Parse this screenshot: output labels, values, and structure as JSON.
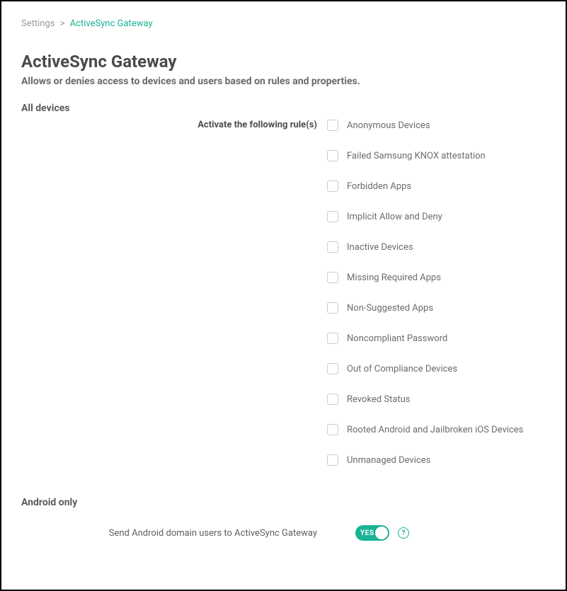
{
  "breadcrumb": {
    "parent": "Settings",
    "current": "ActiveSync Gateway"
  },
  "header": {
    "title": "ActiveSync Gateway",
    "subtitle": "Allows or denies access to devices and users based on rules and properties."
  },
  "sections": {
    "allDevices": {
      "heading": "All devices",
      "rulesLabel": "Activate the following rule(s)",
      "rules": [
        "Anonymous Devices",
        "Failed Samsung KNOX attestation",
        "Forbidden Apps",
        "Implicit Allow and Deny",
        "Inactive Devices",
        "Missing Required Apps",
        "Non-Suggested Apps",
        "Noncompliant Password",
        "Out of Compliance Devices",
        "Revoked Status",
        "Rooted Android and Jailbroken iOS Devices",
        "Unmanaged Devices"
      ]
    },
    "androidOnly": {
      "heading": "Android only",
      "toggleLabel": "Send Android domain users to ActiveSync Gateway",
      "toggleValue": "YES",
      "helpGlyph": "?"
    }
  }
}
